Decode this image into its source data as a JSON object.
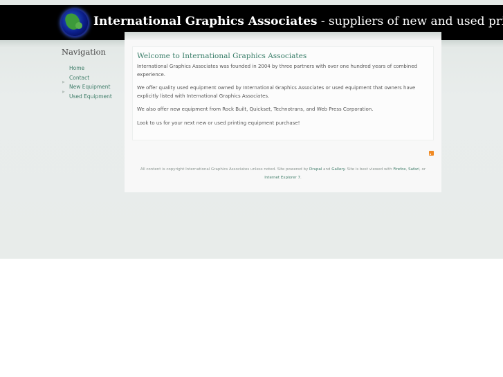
{
  "header": {
    "site_name": "International Graphics Associates",
    "slogan": " - suppliers of new and used printing equipment"
  },
  "sidebar": {
    "heading": "Navigation",
    "items": [
      {
        "label": "Home"
      },
      {
        "label": "Contact"
      },
      {
        "label": "New Equipment"
      },
      {
        "label": "Used Equipment"
      }
    ]
  },
  "content": {
    "title": "Welcome to International Graphics Associates",
    "paragraphs": [
      "International Graphics Associates was founded in 2004 by three partners with over one hundred years of combined experience.",
      "We offer quality used equipment owned by International Graphics Associates or used equipment that owners have explicitly listed with International Graphics Associates.",
      "We also offer new equipment from Rock Built, Quickset, Technotrans, and Web Press Corporation.",
      "Look to us for your next new or used printing equipment purchase!"
    ]
  },
  "footer": {
    "text1": "All content is copyright International Graphics Associates unless noted. Site powered by ",
    "link_drupal": "Drupal",
    "text2": " and ",
    "link_gallery": "Gallery",
    "text3": ". Site is best viewed with ",
    "link_firefox": "Firefox",
    "text4": ", ",
    "link_safari": "Safari",
    "text5": ", or",
    "link_ie": "Internet Explorer 7",
    "text6": "."
  },
  "icons": {
    "logo": "globe-logo-icon",
    "feed": "rss-feed-icon"
  },
  "colors": {
    "header_bg": "#000000",
    "link": "#3e7c68",
    "rss": "#f08a24"
  }
}
